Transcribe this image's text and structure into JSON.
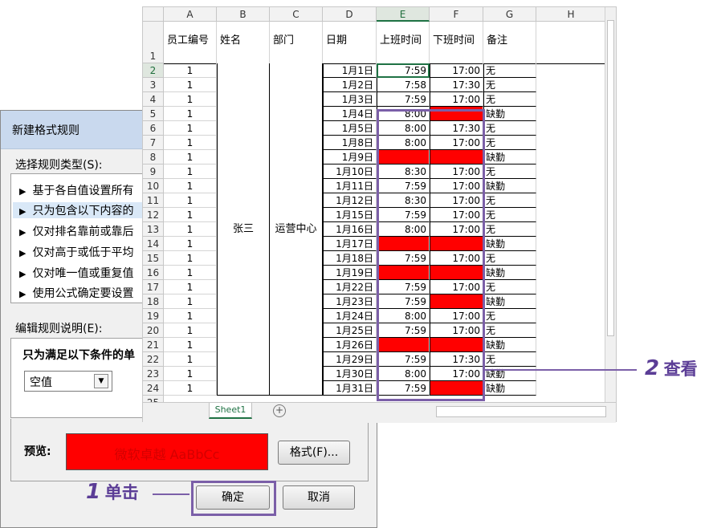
{
  "dialog": {
    "title": "新建格式规则",
    "rule_type_label": "选择规则类型(S):",
    "rule_types": [
      "基于各自值设置所有",
      "只为包含以下内容的",
      "仅对排名靠前或靠后",
      "仅对高于或低于平均",
      "仅对唯一值或重复值",
      "使用公式确定要设置"
    ],
    "edit_desc_label": "编辑规则说明(E):",
    "condition_title": "只为满足以下条件的单",
    "condition_value": "空值",
    "preview_label": "预览:",
    "preview_text": "微软卓越 AaBbCc",
    "format_button": "格式(F)...",
    "ok_button": "确定",
    "cancel_button": "取消"
  },
  "sheet": {
    "columns": [
      "A",
      "B",
      "C",
      "D",
      "E",
      "F",
      "G",
      "H"
    ],
    "headers": [
      "员工编号",
      "姓名",
      "部门",
      "日期",
      "上班时间",
      "下班时间",
      "备注"
    ],
    "name": "张三",
    "dept": "运营中心",
    "rows": [
      {
        "r": "2",
        "id": "1",
        "date": "1月1日",
        "in": "7:59",
        "out": "17:00",
        "note": "无"
      },
      {
        "r": "3",
        "id": "1",
        "date": "1月2日",
        "in": "7:58",
        "out": "17:30",
        "note": "无"
      },
      {
        "r": "4",
        "id": "1",
        "date": "1月3日",
        "in": "7:59",
        "out": "17:00",
        "note": "无"
      },
      {
        "r": "5",
        "id": "1",
        "date": "1月4日",
        "in": "8:00",
        "out": "",
        "note": "缺勤"
      },
      {
        "r": "6",
        "id": "1",
        "date": "1月5日",
        "in": "8:00",
        "out": "17:30",
        "note": "无"
      },
      {
        "r": "7",
        "id": "1",
        "date": "1月8日",
        "in": "8:00",
        "out": "17:00",
        "note": "无"
      },
      {
        "r": "8",
        "id": "1",
        "date": "1月9日",
        "in": "",
        "out": "",
        "note": "缺勤"
      },
      {
        "r": "9",
        "id": "1",
        "date": "1月10日",
        "in": "8:30",
        "out": "17:00",
        "note": "无"
      },
      {
        "r": "10",
        "id": "1",
        "date": "1月11日",
        "in": "7:59",
        "out": "17:00",
        "note": "缺勤"
      },
      {
        "r": "11",
        "id": "1",
        "date": "1月12日",
        "in": "8:30",
        "out": "17:00",
        "note": "无"
      },
      {
        "r": "12",
        "id": "1",
        "date": "1月15日",
        "in": "7:59",
        "out": "17:00",
        "note": "无"
      },
      {
        "r": "13",
        "id": "1",
        "date": "1月16日",
        "in": "8:00",
        "out": "17:00",
        "note": "无"
      },
      {
        "r": "14",
        "id": "1",
        "date": "1月17日",
        "in": "",
        "out": "",
        "note": "缺勤"
      },
      {
        "r": "15",
        "id": "1",
        "date": "1月18日",
        "in": "7:59",
        "out": "17:00",
        "note": "无"
      },
      {
        "r": "16",
        "id": "1",
        "date": "1月19日",
        "in": "",
        "out": "",
        "note": "缺勤"
      },
      {
        "r": "17",
        "id": "1",
        "date": "1月22日",
        "in": "7:59",
        "out": "17:00",
        "note": "无"
      },
      {
        "r": "18",
        "id": "1",
        "date": "1月23日",
        "in": "7:59",
        "out": "",
        "note": "缺勤"
      },
      {
        "r": "19",
        "id": "1",
        "date": "1月24日",
        "in": "8:00",
        "out": "17:00",
        "note": "无"
      },
      {
        "r": "20",
        "id": "1",
        "date": "1月25日",
        "in": "7:59",
        "out": "17:00",
        "note": "无"
      },
      {
        "r": "21",
        "id": "1",
        "date": "1月26日",
        "in": "",
        "out": "",
        "note": "缺勤"
      },
      {
        "r": "22",
        "id": "1",
        "date": "1月29日",
        "in": "7:59",
        "out": "17:30",
        "note": "无"
      },
      {
        "r": "23",
        "id": "1",
        "date": "1月30日",
        "in": "8:00",
        "out": "17:00",
        "note": "缺勤"
      },
      {
        "r": "24",
        "id": "1",
        "date": "1月31日",
        "in": "7:59",
        "out": "",
        "note": "缺勤"
      }
    ],
    "tab_name": "Sheet1",
    "add_sheet_icon": "+",
    "empty_fill": "#ff0000"
  },
  "annotations": {
    "step1_num": "1",
    "step1_text": "单击",
    "step2_num": "2",
    "step2_text": "查看",
    "accent": "#7b5fa8"
  }
}
